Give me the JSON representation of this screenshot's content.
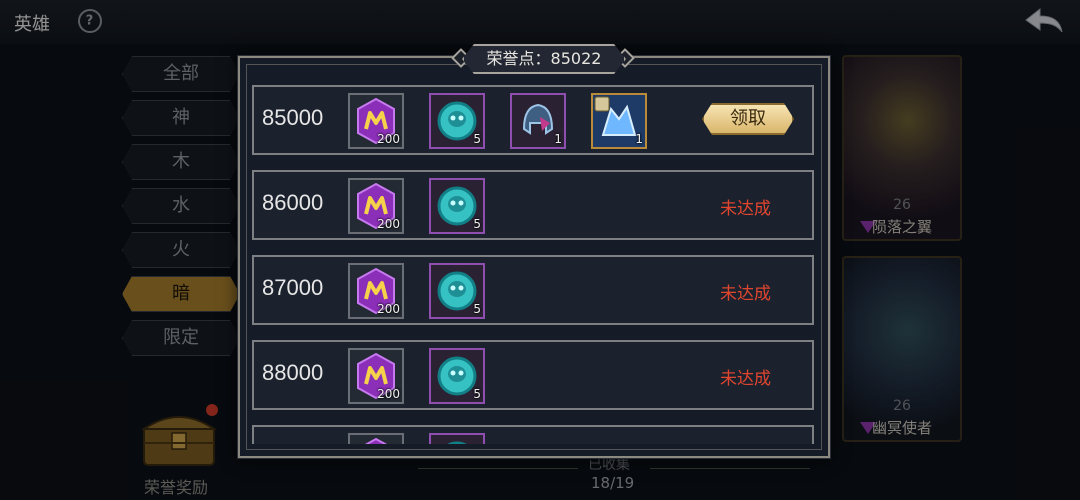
{
  "header": {
    "title": "英雄",
    "help_icon": "?"
  },
  "categories": [
    {
      "label": "全部",
      "active": false
    },
    {
      "label": "神",
      "active": false
    },
    {
      "label": "木",
      "active": false
    },
    {
      "label": "水",
      "active": false
    },
    {
      "label": "火",
      "active": false
    },
    {
      "label": "暗",
      "active": true
    },
    {
      "label": "限定",
      "active": false
    }
  ],
  "chest": {
    "label": "荣誉奖励"
  },
  "hero_cards": [
    {
      "level": "26",
      "name": "陨落之翼"
    },
    {
      "level": "26",
      "name": "幽冥使者"
    }
  ],
  "collection": {
    "label": "已收集",
    "count": "18/19"
  },
  "modal": {
    "honor_text": "荣誉点：85022",
    "rows": [
      {
        "points": "85000",
        "items": [
          {
            "icon": "purple-crystal-icon",
            "qty": "200"
          },
          {
            "icon": "cyan-skull-token-icon",
            "qty": "5"
          },
          {
            "icon": "helmet-icon",
            "qty": "1"
          },
          {
            "icon": "blue-armor-icon",
            "qty": "1"
          }
        ],
        "action": "领取",
        "claimable": true
      },
      {
        "points": "86000",
        "items": [
          {
            "icon": "purple-crystal-icon",
            "qty": "200"
          },
          {
            "icon": "cyan-skull-token-icon",
            "qty": "5"
          }
        ],
        "status": "未达成",
        "claimable": false
      },
      {
        "points": "87000",
        "items": [
          {
            "icon": "purple-crystal-icon",
            "qty": "200"
          },
          {
            "icon": "cyan-skull-token-icon",
            "qty": "5"
          }
        ],
        "status": "未达成",
        "claimable": false
      },
      {
        "points": "88000",
        "items": [
          {
            "icon": "purple-crystal-icon",
            "qty": "200"
          },
          {
            "icon": "cyan-skull-token-icon",
            "qty": "5"
          }
        ],
        "status": "未达成",
        "claimable": false
      }
    ]
  },
  "colors": {
    "status_unreached": "#e0452e",
    "claim_button": "#e8cd8d",
    "active_category": "#a27a2c"
  }
}
